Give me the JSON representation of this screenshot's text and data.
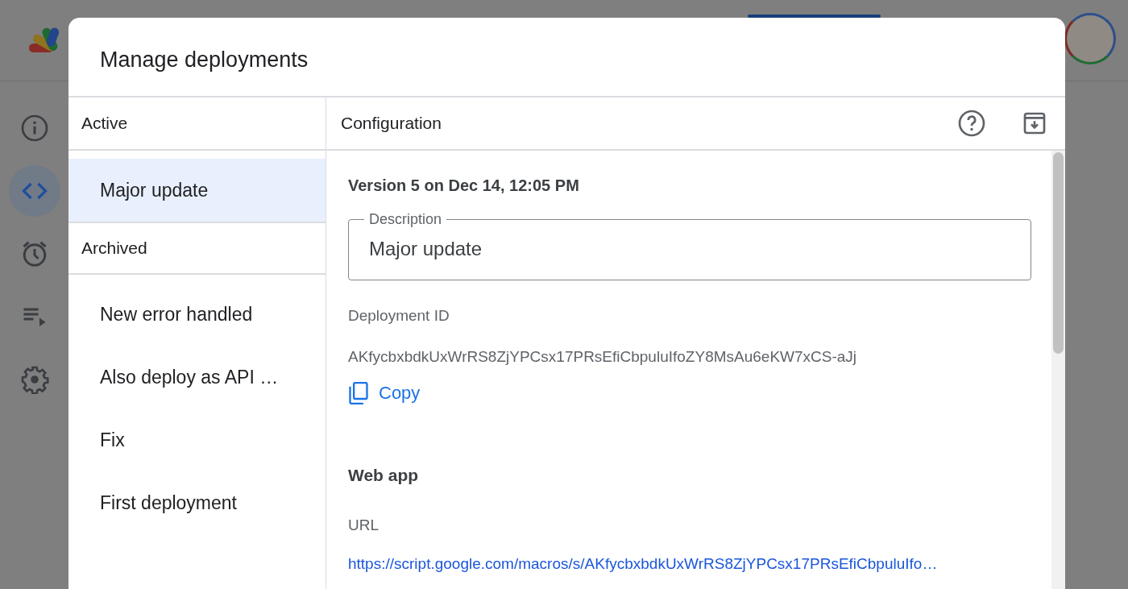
{
  "nav_rail": [
    {
      "kind": "info",
      "selected": false
    },
    {
      "kind": "code",
      "selected": true
    },
    {
      "kind": "clock",
      "selected": false
    },
    {
      "kind": "executions",
      "selected": false
    },
    {
      "kind": "settings",
      "selected": false
    }
  ],
  "dialog": {
    "title": "Manage deployments",
    "list_panel": {
      "active_heading": "Active",
      "active": [
        {
          "label": "Major update",
          "selected": true
        }
      ],
      "archived_heading": "Archived",
      "archived": [
        {
          "label": "New error handled",
          "selected": false
        },
        {
          "label": "Also deploy as API …",
          "selected": false
        },
        {
          "label": "Fix",
          "selected": false
        },
        {
          "label": "First deployment",
          "selected": false
        }
      ]
    },
    "config": {
      "heading": "Configuration",
      "version": "Version 5 on Dec 14, 12:05 PM",
      "description": {
        "label": "Description",
        "value": "Major update"
      },
      "deployment_id_label": "Deployment ID",
      "deployment_id": "AKfycbxbdkUxWrRS8ZjYPCsx17PRsEfiCbpuluIfoZY8MsAu6eKW7xCS-aJj",
      "copy": "Copy",
      "web_app_heading": "Web app",
      "url_label": "URL",
      "url": "https://script.google.com/macros/s/AKfycbxbdkUxWrRS8ZjYPCsx17PRsEfiCbpuluIfo…"
    }
  }
}
